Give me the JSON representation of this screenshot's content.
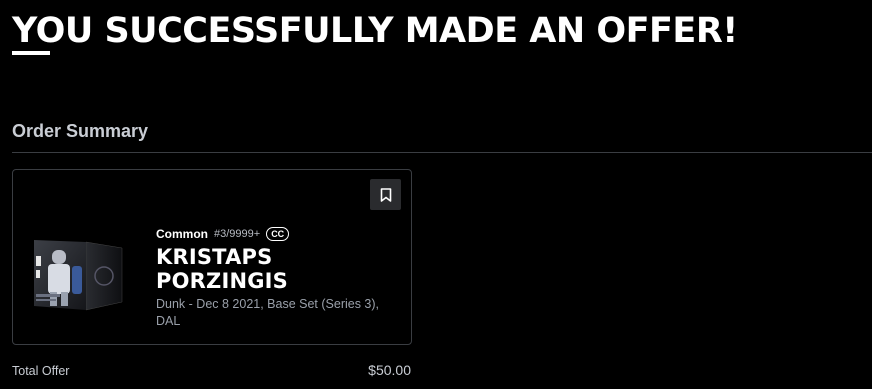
{
  "headline": "YOU SUCCESSFULLY MADE AN OFFER!",
  "order_summary": {
    "title": "Order Summary"
  },
  "moment": {
    "rarity": "Common",
    "serial": "#3/9999+",
    "badge": "CC",
    "player_name": "KRISTAPS PORZINGIS",
    "description": "Dunk - Dec 8 2021, Base Set (Series 3), DAL",
    "bookmark_icon": "bookmark-icon",
    "thumbnail_icon": "moment-card-thumbnail"
  },
  "total": {
    "label": "Total Offer",
    "value": "$50.00"
  },
  "colors": {
    "background": "#000000",
    "text_primary": "#ffffff",
    "text_muted": "#9aa0aa",
    "border": "#3a3d42",
    "button_bg": "#2a2b2e"
  }
}
